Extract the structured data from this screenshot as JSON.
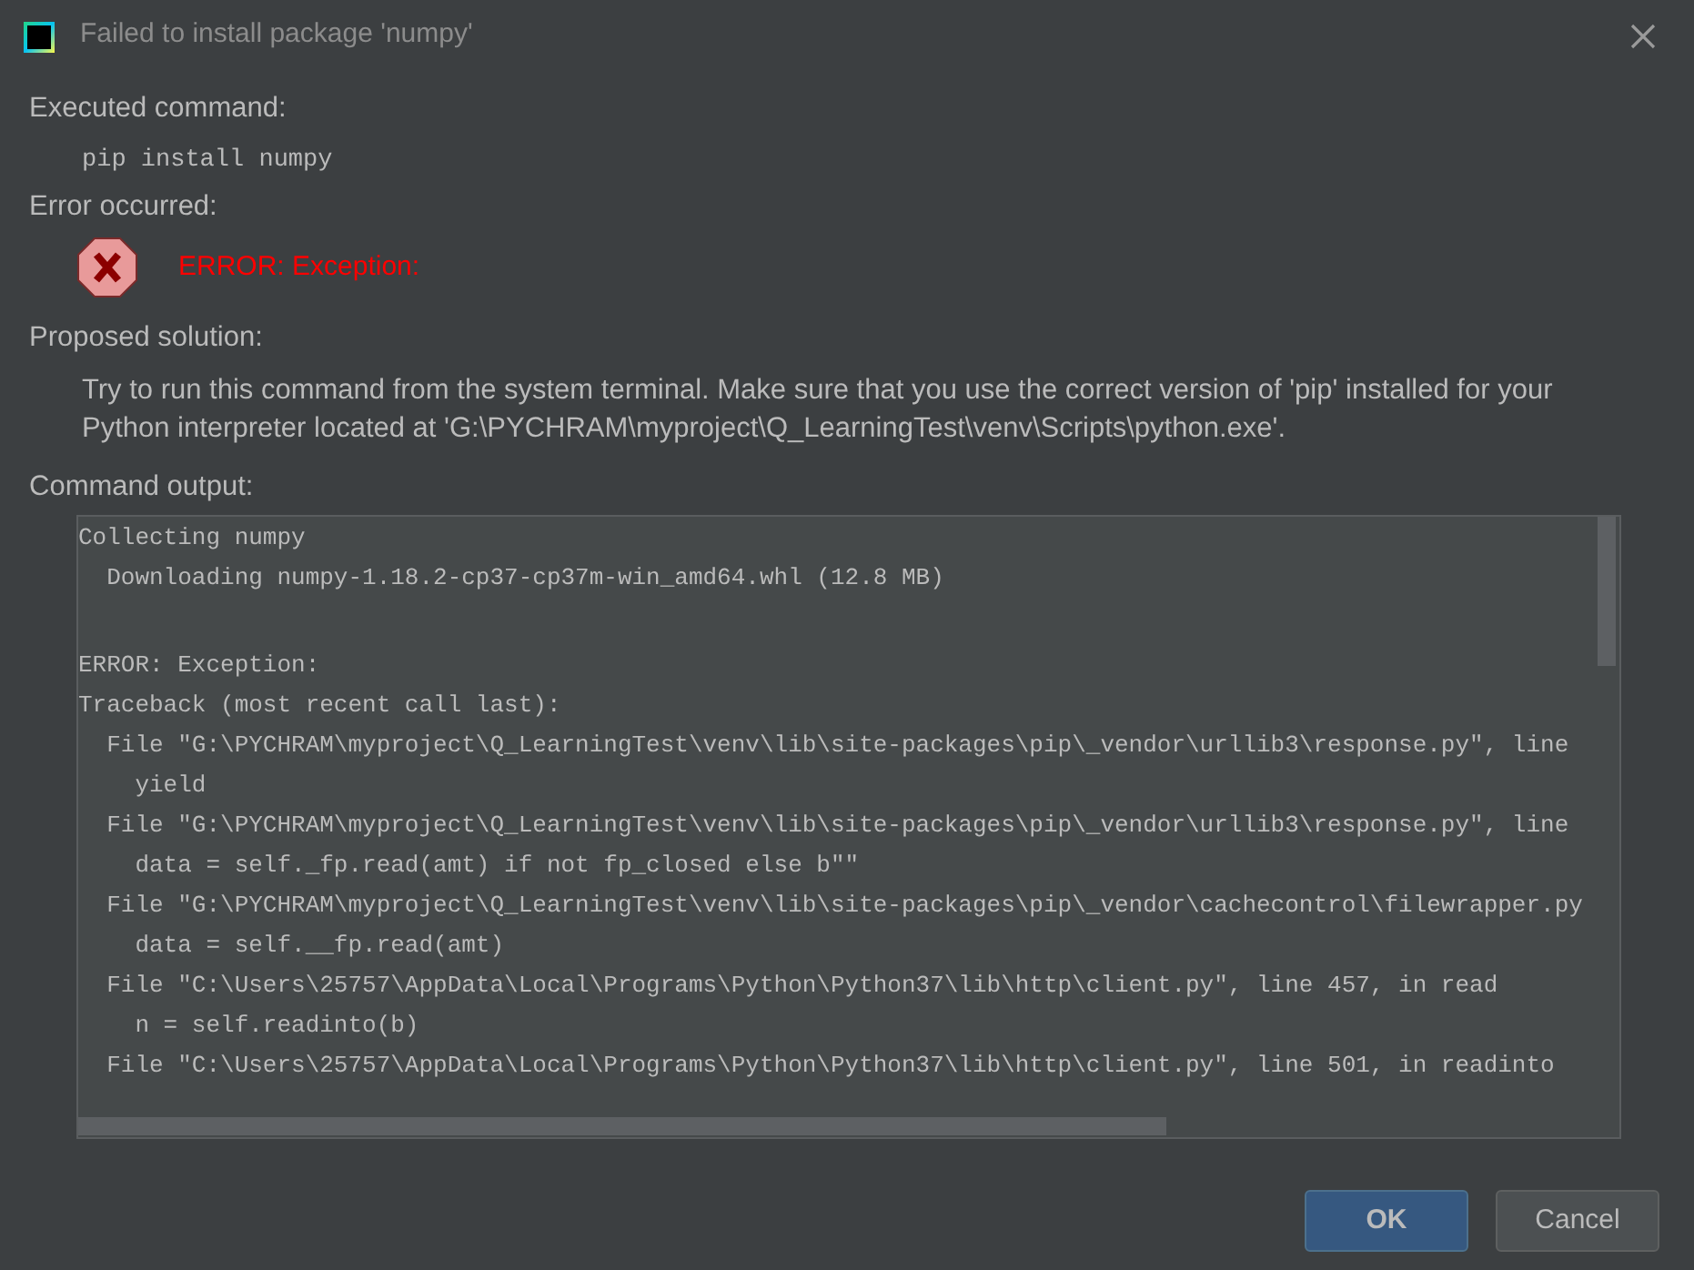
{
  "window": {
    "title": "Failed to install package 'numpy'"
  },
  "executed": {
    "heading": "Executed command:",
    "command": "pip install numpy"
  },
  "error": {
    "heading": "Error occurred:",
    "message": "ERROR: Exception:"
  },
  "solution": {
    "heading": "Proposed solution:",
    "text": "Try to run this command from the system terminal. Make sure that you use the correct version of 'pip' installed for your Python interpreter located at 'G:\\PYCHRAM\\myproject\\Q_LearningTest\\venv\\Scripts\\python.exe'."
  },
  "output": {
    "heading": "Command output:",
    "paragraphs": [
      [
        "Collecting numpy",
        "  Downloading numpy-1.18.2-cp37-cp37m-win_amd64.whl (12.8 MB)"
      ],
      [
        "ERROR: Exception:",
        "Traceback (most recent call last):",
        "  File \"G:\\PYCHRAM\\myproject\\Q_LearningTest\\venv\\lib\\site-packages\\pip\\_vendor\\urllib3\\response.py\", line",
        "    yield",
        "  File \"G:\\PYCHRAM\\myproject\\Q_LearningTest\\venv\\lib\\site-packages\\pip\\_vendor\\urllib3\\response.py\", line",
        "    data = self._fp.read(amt) if not fp_closed else b\"\"",
        "  File \"G:\\PYCHRAM\\myproject\\Q_LearningTest\\venv\\lib\\site-packages\\pip\\_vendor\\cachecontrol\\filewrapper.py",
        "    data = self.__fp.read(amt)",
        "  File \"C:\\Users\\25757\\AppData\\Local\\Programs\\Python\\Python37\\lib\\http\\client.py\", line 457, in read",
        "    n = self.readinto(b)",
        "  File \"C:\\Users\\25757\\AppData\\Local\\Programs\\Python\\Python37\\lib\\http\\client.py\", line 501, in readinto"
      ]
    ]
  },
  "buttons": [
    {
      "label": "OK",
      "default": true
    },
    {
      "label": "Cancel",
      "default": false
    }
  ]
}
